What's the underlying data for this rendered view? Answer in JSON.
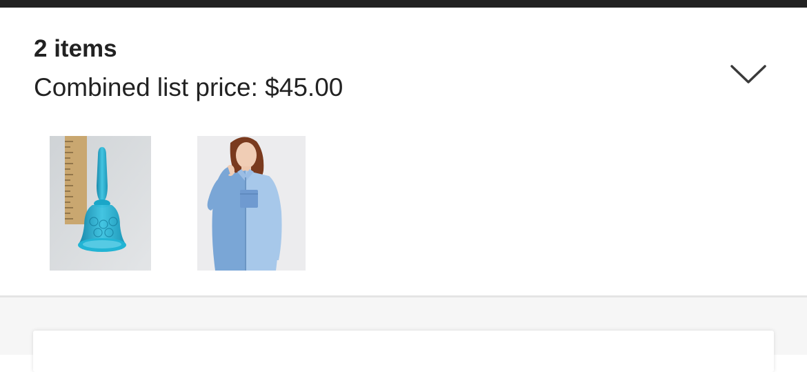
{
  "cart_summary": {
    "item_count_label": "2 items",
    "combined_price_label": "Combined list price: $45.00",
    "expand_icon": "chevron-down-icon"
  },
  "products": [
    {
      "name": "blue-glass-bell",
      "accent": "#1fa3c4"
    },
    {
      "name": "two-tone-denim-shirt",
      "accent": "#8bb8e0"
    }
  ],
  "colors": {
    "text": "#222222",
    "top_bar": "#222222",
    "divider": "#e4e4e4",
    "lower_background": "#f6f6f6"
  }
}
